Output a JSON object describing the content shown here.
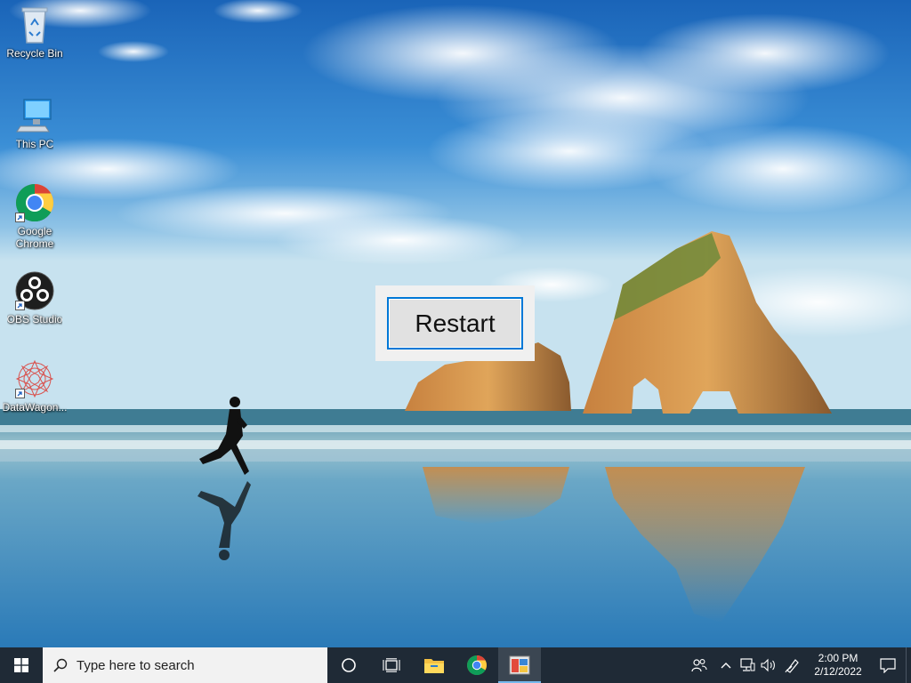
{
  "desktop": {
    "icons": [
      {
        "name": "recycle-bin",
        "label": "Recycle Bin"
      },
      {
        "name": "this-pc",
        "label": "This PC"
      },
      {
        "name": "google-chrome",
        "label": "Google Chrome"
      },
      {
        "name": "obs-studio",
        "label": "OBS Studio"
      },
      {
        "name": "datawagon",
        "label": "DataWagon..."
      }
    ]
  },
  "dialog": {
    "restart_label": "Restart"
  },
  "taskbar": {
    "search_placeholder": "Type here to search",
    "apps": [
      "cortana-icon",
      "task-view-icon",
      "file-explorer-icon",
      "chrome-icon",
      "active-app-icon"
    ],
    "clock": {
      "time": "2:00 PM",
      "date": "2/12/2022"
    },
    "tray_icons": [
      "people-icon",
      "chevron-up-icon",
      "network-icon",
      "volume-icon",
      "pen-icon"
    ]
  },
  "colors": {
    "taskbar": "#1f2a36",
    "accent": "#0078d7"
  }
}
